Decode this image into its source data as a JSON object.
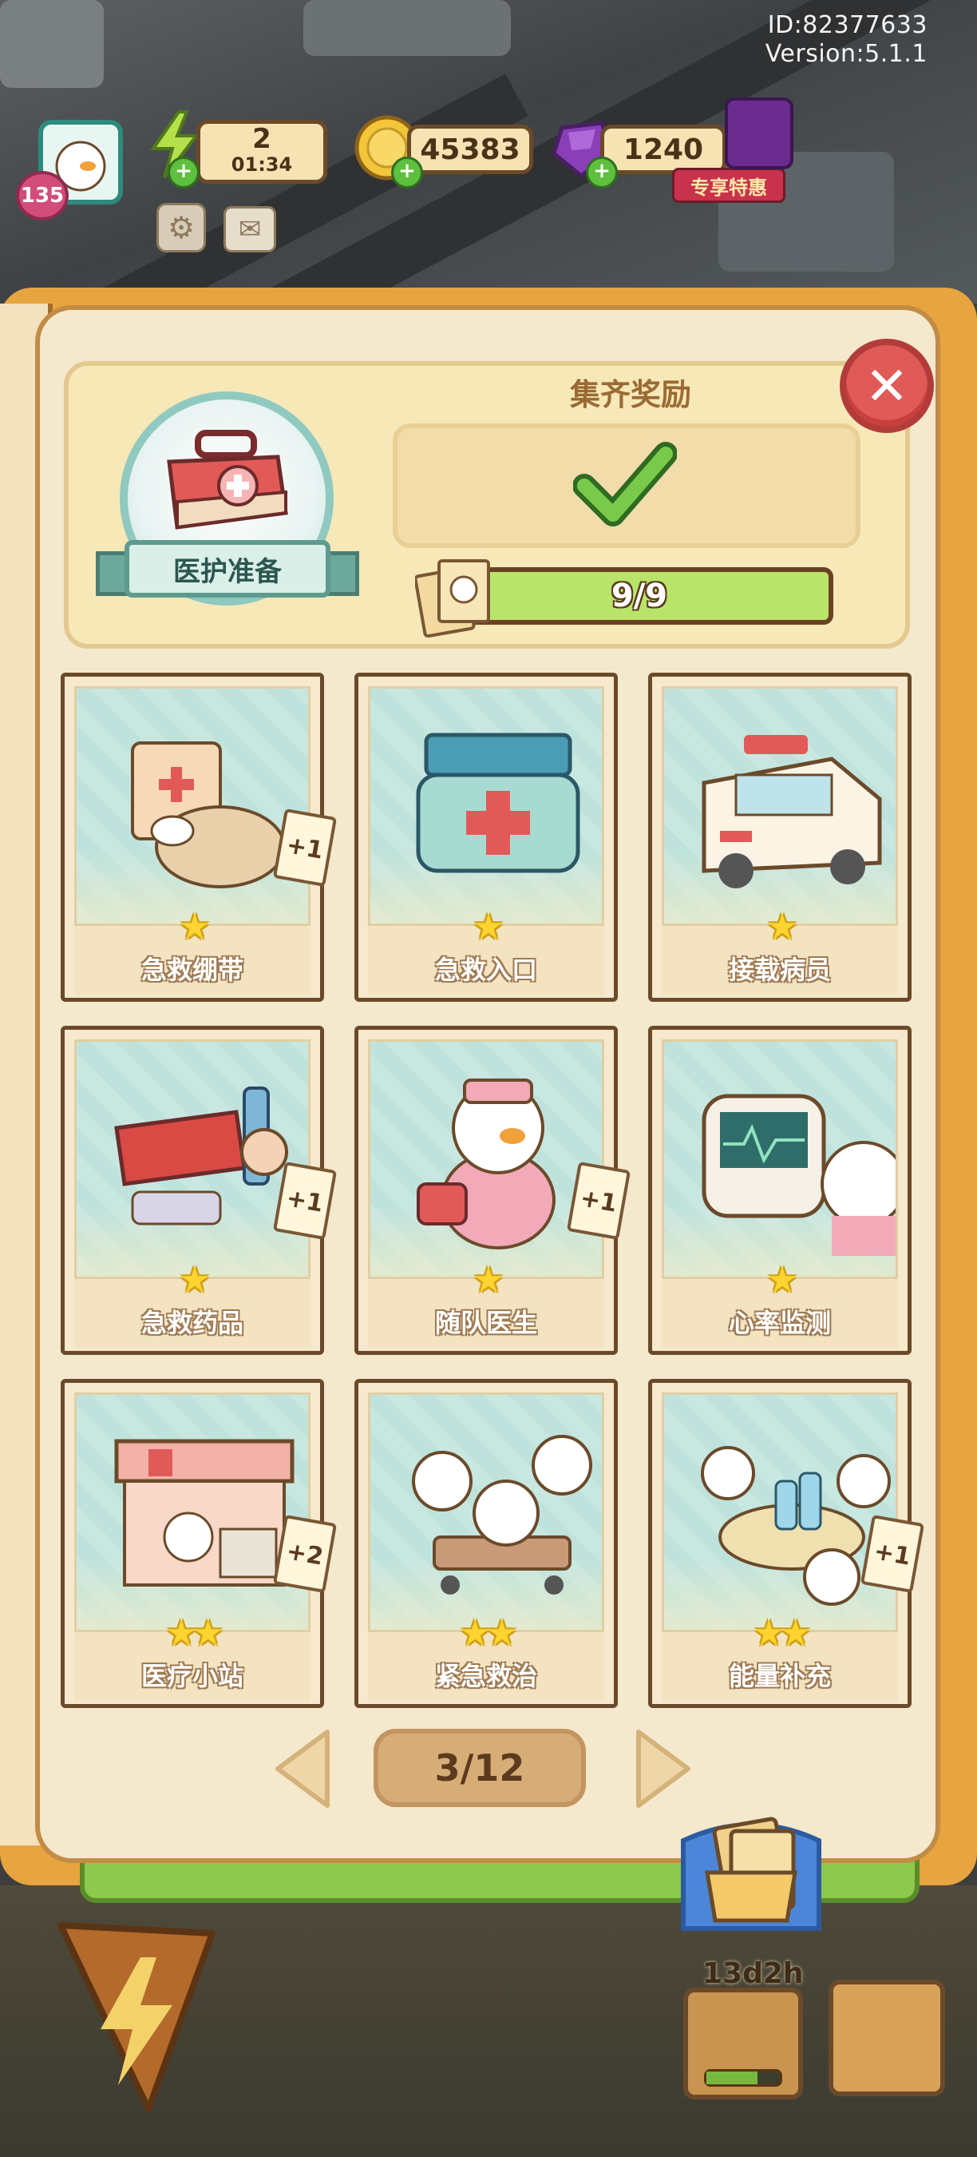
{
  "hud": {
    "id_text": "ID:82377633",
    "version_text": "Version:5.1.1",
    "level": "135",
    "energy": "2",
    "energy_timer": "01:34",
    "coins": "45383",
    "gems": "1240",
    "promo_label": "专享特惠"
  },
  "collection": {
    "name": "医护准备",
    "reward_title": "集齐奖励",
    "progress_text": "9/9",
    "progress_fraction": 1.0,
    "page_text": "3/12"
  },
  "cards": [
    {
      "name": "急救绷带",
      "stars": "★",
      "dup": "+1",
      "art": "bandage"
    },
    {
      "name": "急救入口",
      "stars": "★",
      "dup": "",
      "art": "entrance"
    },
    {
      "name": "接载病员",
      "stars": "★",
      "dup": "",
      "art": "ambulance"
    },
    {
      "name": "急救药品",
      "stars": "★",
      "dup": "+1",
      "art": "medicine"
    },
    {
      "name": "随队医生",
      "stars": "★",
      "dup": "+1",
      "art": "doctor"
    },
    {
      "name": "心率监测",
      "stars": "★",
      "dup": "",
      "art": "monitor"
    },
    {
      "name": "医疗小站",
      "stars": "★★",
      "dup": "+2",
      "art": "station"
    },
    {
      "name": "紧急救治",
      "stars": "★★",
      "dup": "",
      "art": "stretcher"
    },
    {
      "name": "能量补充",
      "stars": "★★",
      "dup": "+1",
      "art": "drinks"
    }
  ],
  "bottom": {
    "timer": "13d2h"
  },
  "colors": {
    "card_border": "#6b4a2a",
    "progress_green": "#a6d65c",
    "close_red": "#e05a58",
    "star_yellow": "#ffd431"
  }
}
